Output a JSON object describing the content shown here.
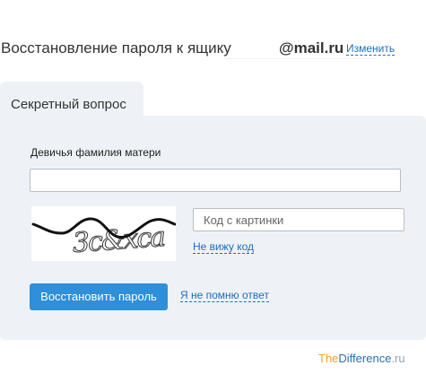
{
  "header": {
    "title": "Восстановление пароля к ящику",
    "domain": "@mail.ru",
    "change_link": "Изменить"
  },
  "tab": {
    "label": "Секретный вопрос"
  },
  "form": {
    "question_label": "Девичья фамилия матери",
    "answer_value": "",
    "captcha_placeholder": "Код с картинки",
    "captcha_text": "3c&xca",
    "captcha_refresh_link": "Не вижу код",
    "submit_label": "Восстановить пароль",
    "forgot_link": "Я не помню ответ"
  },
  "watermark": {
    "part1": "The",
    "part2": "Difference",
    "part3": ".ru"
  },
  "colors": {
    "accent": "#2f8fd8",
    "link": "#1a6fc4",
    "panel_bg": "#eef2f6"
  }
}
